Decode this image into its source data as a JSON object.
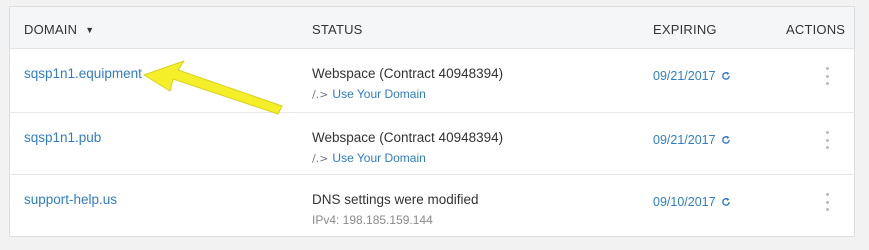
{
  "header": {
    "domain": "DOMAIN",
    "sort_icon": "caret-down-icon",
    "status": "STATUS",
    "expiring": "EXPIRING",
    "actions": "ACTIONS"
  },
  "rows": [
    {
      "domain": "sqsp1n1.equipment",
      "status": "Webspace (Contract 40948394)",
      "sub_icon": "/.>",
      "sub_text": "Use Your Domain",
      "expiring": "09/21/2017"
    },
    {
      "domain": "sqsp1n1.pub",
      "status": "Webspace (Contract 40948394)",
      "sub_icon": "/.>",
      "sub_text": "Use Your Domain",
      "expiring": "09/21/2017"
    },
    {
      "domain": "support-help.us",
      "status": "DNS settings were modified",
      "sub_text": "IPv4: 198.185.159.144",
      "expiring": "09/10/2017"
    }
  ],
  "colors": {
    "link": "#2f7dc6",
    "arrow": "#f5ef2a",
    "header_bg": "#f5f6f7"
  },
  "icons": {
    "refresh": "refresh-icon",
    "actions": "kebab-menu-icon",
    "annotation": "yellow-arrow-annotation"
  }
}
